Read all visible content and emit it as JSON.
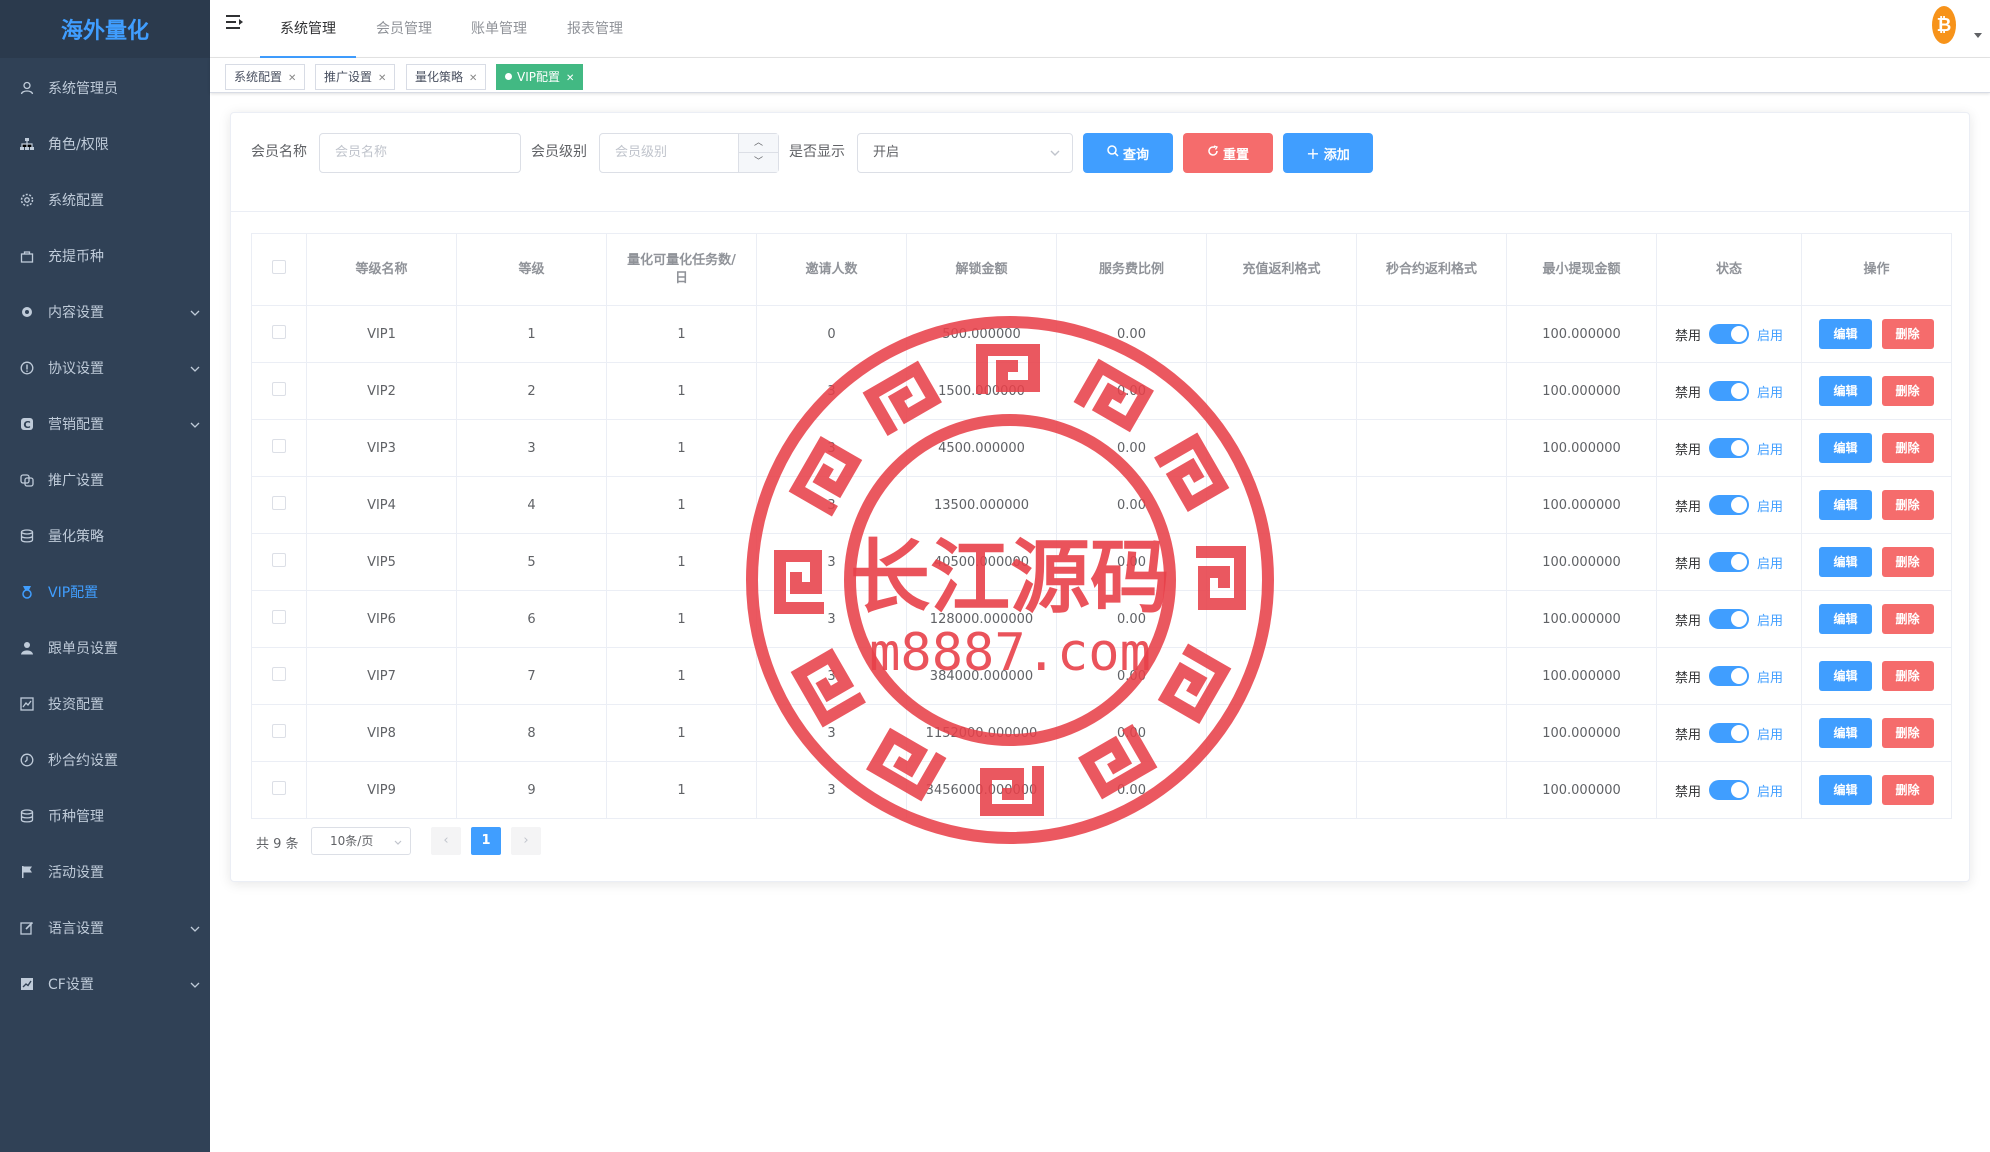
{
  "app": {
    "logo": "海外量化"
  },
  "sidebar": {
    "items": [
      {
        "label": "系统管理员",
        "icon": "user-icon",
        "chevron": false
      },
      {
        "label": "角色/权限",
        "icon": "org-chart-icon",
        "chevron": false
      },
      {
        "label": "系统配置",
        "icon": "gear-icon",
        "chevron": false
      },
      {
        "label": "充提币种",
        "icon": "bag-icon",
        "chevron": false
      },
      {
        "label": "内容设置",
        "icon": "cog-icon",
        "chevron": true
      },
      {
        "label": "协议设置",
        "icon": "info-icon",
        "chevron": true
      },
      {
        "label": "营销配置",
        "icon": "marketing-icon",
        "chevron": true
      },
      {
        "label": "推广设置",
        "icon": "promo-icon",
        "chevron": false
      },
      {
        "label": "量化策略",
        "icon": "database-icon",
        "chevron": false
      },
      {
        "label": "VIP配置",
        "icon": "medal-icon",
        "chevron": false,
        "active": true
      },
      {
        "label": "跟单员设置",
        "icon": "person-icon",
        "chevron": false
      },
      {
        "label": "投资配置",
        "icon": "chart-icon",
        "chevron": false
      },
      {
        "label": "秒合约设置",
        "icon": "clock-icon",
        "chevron": false
      },
      {
        "label": "币种管理",
        "icon": "database-icon",
        "chevron": false
      },
      {
        "label": "活动设置",
        "icon": "flag-icon",
        "chevron": false
      },
      {
        "label": "语言设置",
        "icon": "edit-icon",
        "chevron": true
      },
      {
        "label": "CF设置",
        "icon": "trend-icon",
        "chevron": true
      }
    ]
  },
  "header": {
    "tabs": [
      "系统管理",
      "会员管理",
      "账单管理",
      "报表管理"
    ],
    "active_tab": 0,
    "coin_symbol": "₿"
  },
  "tags": [
    {
      "label": "系统配置",
      "active": false
    },
    {
      "label": "推广设置",
      "active": false
    },
    {
      "label": "量化策略",
      "active": false
    },
    {
      "label": "VIP配置",
      "active": true
    }
  ],
  "filters": {
    "name_label": "会员名称",
    "name_placeholder": "会员名称",
    "level_label": "会员级别",
    "level_placeholder": "会员级别",
    "display_label": "是否显示",
    "display_value": "开启",
    "search_btn": "查询",
    "reset_btn": "重置",
    "add_btn": "添加"
  },
  "table": {
    "headers": [
      "等级名称",
      "等级",
      "量化可量化任务数/日",
      "邀请人数",
      "解锁金额",
      "服务费比例",
      "充值返利格式",
      "秒合约返利格式",
      "最小提现金额",
      "状态",
      "操作"
    ],
    "status_off": "禁用",
    "status_on": "启用",
    "edit_btn": "编辑",
    "delete_btn": "删除",
    "rows": [
      {
        "name": "VIP1",
        "level": "1",
        "tasks": "1",
        "invites": "0",
        "unlock": "500.000000",
        "fee": "0.00",
        "recharge": "",
        "second": "",
        "min_withdraw": "100.000000"
      },
      {
        "name": "VIP2",
        "level": "2",
        "tasks": "1",
        "invites": "3",
        "unlock": "1500.000000",
        "fee": "0.00",
        "recharge": "",
        "second": "",
        "min_withdraw": "100.000000"
      },
      {
        "name": "VIP3",
        "level": "3",
        "tasks": "1",
        "invites": "3",
        "unlock": "4500.000000",
        "fee": "0.00",
        "recharge": "",
        "second": "",
        "min_withdraw": "100.000000"
      },
      {
        "name": "VIP4",
        "level": "4",
        "tasks": "1",
        "invites": "3",
        "unlock": "13500.000000",
        "fee": "0.00",
        "recharge": "",
        "second": "",
        "min_withdraw": "100.000000"
      },
      {
        "name": "VIP5",
        "level": "5",
        "tasks": "1",
        "invites": "3",
        "unlock": "40500.000000",
        "fee": "0.00",
        "recharge": "",
        "second": "",
        "min_withdraw": "100.000000"
      },
      {
        "name": "VIP6",
        "level": "6",
        "tasks": "1",
        "invites": "3",
        "unlock": "128000.000000",
        "fee": "0.00",
        "recharge": "",
        "second": "",
        "min_withdraw": "100.000000"
      },
      {
        "name": "VIP7",
        "level": "7",
        "tasks": "1",
        "invites": "3",
        "unlock": "384000.000000",
        "fee": "0.00",
        "recharge": "",
        "second": "",
        "min_withdraw": "100.000000"
      },
      {
        "name": "VIP8",
        "level": "8",
        "tasks": "1",
        "invites": "3",
        "unlock": "1152000.000000",
        "fee": "0.00",
        "recharge": "",
        "second": "",
        "min_withdraw": "100.000000"
      },
      {
        "name": "VIP9",
        "level": "9",
        "tasks": "1",
        "invites": "3",
        "unlock": "3456000.000000",
        "fee": "0.00",
        "recharge": "",
        "second": "",
        "min_withdraw": "100.000000"
      }
    ]
  },
  "pagination": {
    "total": "共 9 条",
    "page_size": "10条/页",
    "current": "1"
  },
  "watermark": {
    "title": "长江源码",
    "site": "m8887.com",
    "color": "#e8414a"
  }
}
